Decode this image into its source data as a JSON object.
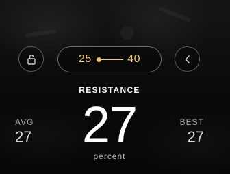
{
  "range": {
    "min": "25",
    "max": "40"
  },
  "metric": {
    "title": "RESISTANCE",
    "value": "27",
    "unit": "percent"
  },
  "stats": {
    "avg_label": "AVG",
    "avg_value": "27",
    "best_label": "BEST",
    "best_value": "27"
  },
  "icons": {
    "lock": "unlocked-lock-icon",
    "back": "chevron-left-icon"
  },
  "colors": {
    "accent": "#f1c47a",
    "text": "#ffffff",
    "muted": "#a5a5a5",
    "border": "#5a5a5a"
  }
}
